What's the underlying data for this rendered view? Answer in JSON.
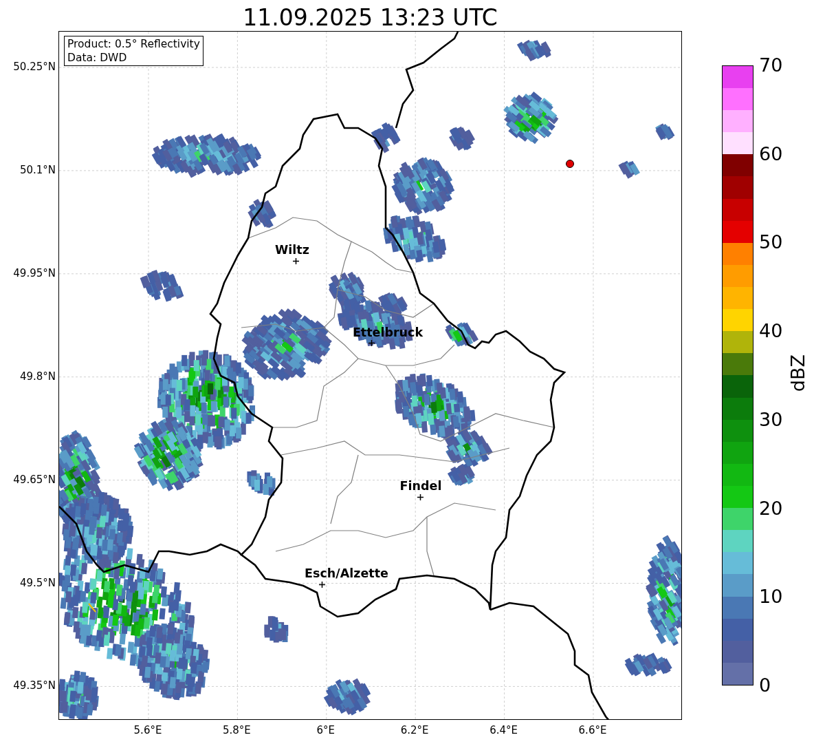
{
  "title": "11.09.2025 13:23 UTC",
  "info_box": {
    "lines": [
      "Product: 0.5° Reflectivity",
      "Data: DWD"
    ]
  },
  "map": {
    "lat_ticks": [
      "50.25°N",
      "50.1°N",
      "49.95°N",
      "49.8°N",
      "49.65°N",
      "49.5°N",
      "49.35°N"
    ],
    "lon_ticks": [
      "5.6°E",
      "5.8°E",
      "6°E",
      "6.2°E",
      "6.4°E",
      "6.6°E"
    ],
    "cities": [
      {
        "name": "Wiltz"
      },
      {
        "name": "Ettelbruck"
      },
      {
        "name": "Findel"
      },
      {
        "name": "Esch/Alzette"
      }
    ]
  },
  "colorbar": {
    "label": "dBZ",
    "ticks": [
      "70",
      "60",
      "50",
      "40",
      "30",
      "20",
      "10",
      "0"
    ],
    "segments": [
      {
        "color": "#6470a8"
      },
      {
        "color": "#525f9e"
      },
      {
        "color": "#4460a6"
      },
      {
        "color": "#4a78b4"
      },
      {
        "color": "#5a9cc8"
      },
      {
        "color": "#66bcd8"
      },
      {
        "color": "#5ed4c0"
      },
      {
        "color": "#3ed46a"
      },
      {
        "color": "#14c814"
      },
      {
        "color": "#12b812"
      },
      {
        "color": "#10a410"
      },
      {
        "color": "#0e900e"
      },
      {
        "color": "#0c7c0c"
      },
      {
        "color": "#0a640a"
      },
      {
        "color": "#4a7a0a"
      },
      {
        "color": "#b0b40a"
      },
      {
        "color": "#ffd400"
      },
      {
        "color": "#ffb400"
      },
      {
        "color": "#ff9c00"
      },
      {
        "color": "#ff8000"
      },
      {
        "color": "#e40000"
      },
      {
        "color": "#c80000"
      },
      {
        "color": "#a00000"
      },
      {
        "color": "#800000"
      },
      {
        "color": "#ffe0ff"
      },
      {
        "color": "#ffb0ff"
      },
      {
        "color": "#ff70ff"
      },
      {
        "color": "#e840f0"
      }
    ]
  }
}
